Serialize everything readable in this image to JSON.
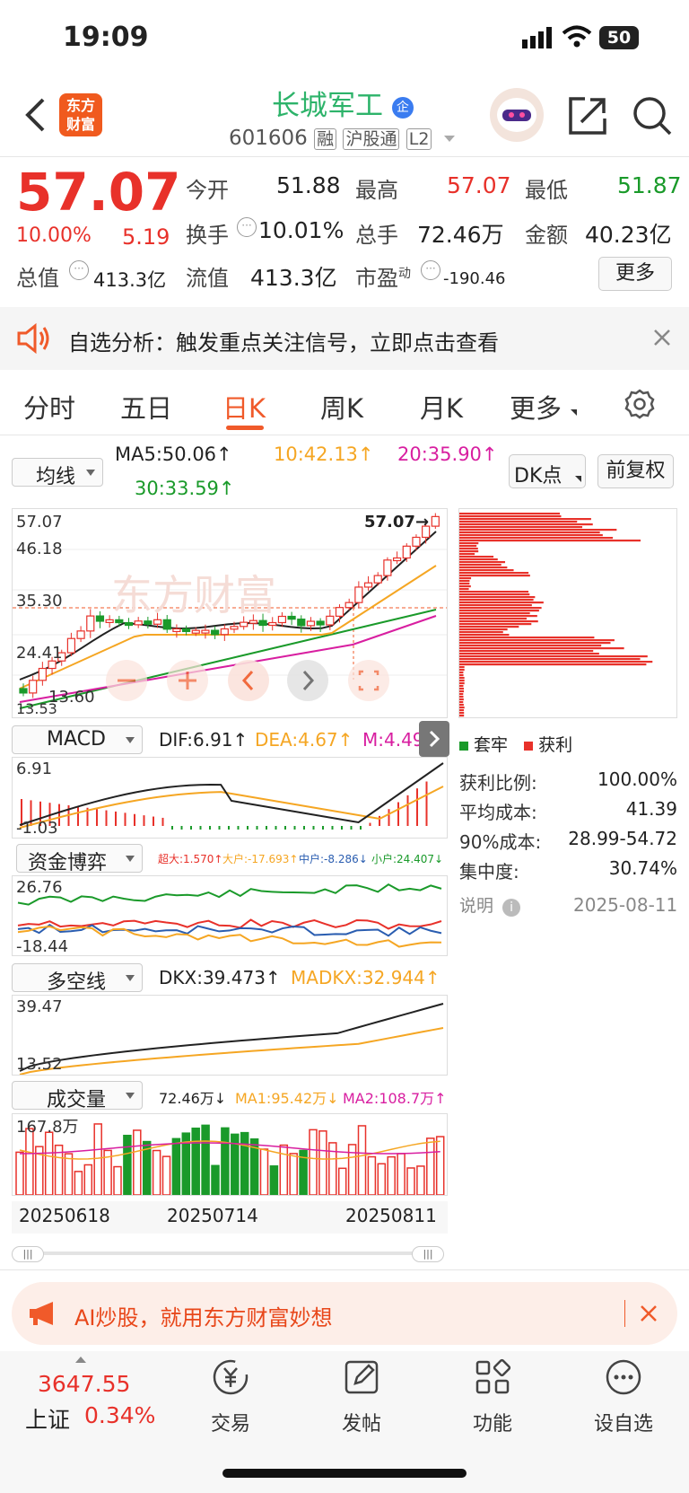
{
  "status_bar": {
    "time": "19:09",
    "battery": "50"
  },
  "header": {
    "logo_text_1": "东方",
    "logo_text_2": "财富",
    "title": "长城军工",
    "title_badge": "企",
    "code": "601606",
    "tags": [
      "融",
      "沪股通",
      "L2"
    ]
  },
  "quote": {
    "price": "57.07",
    "change_pct": "10.00%",
    "change": "5.19",
    "open_label": "今开",
    "open": "51.88",
    "high_label": "最高",
    "high": "57.07",
    "low_label": "最低",
    "low": "51.87",
    "turnover_label": "换手",
    "turnover": "10.01%",
    "volume_label": "总手",
    "volume": "72.46万",
    "amount_label": "金额",
    "amount": "40.23亿",
    "mktcap_label": "总值",
    "mktcap": "413.3亿",
    "float_label": "流值",
    "float": "413.3亿",
    "pe_label": "市盈",
    "pe_sup": "动",
    "pe": "-190.46",
    "more_button": "更多"
  },
  "banner": {
    "text": "自选分析：触发重点关注信号，立即点击查看"
  },
  "tabs": [
    "分时",
    "五日",
    "日K",
    "周K",
    "月K",
    "更多"
  ],
  "active_tab": 2,
  "kline": {
    "ma_selector": "均线",
    "ma5": "MA5:50.06↑",
    "ma10": "10:42.13↑",
    "ma20": "20:35.90↑",
    "ma30": "30:33.59↑",
    "dk_button": "DK点",
    "fq_button": "前复权",
    "y_labels": [
      "57.07",
      "46.18",
      "35.30",
      "24.41",
      "13.60",
      "13.53"
    ],
    "last_price_label": "57.07",
    "watermark": "东方财富",
    "colors": {
      "up": "#e8312a",
      "down": "#1a9a2a",
      "ma5": "#222222",
      "ma10": "#f5a623",
      "ma20": "#d81ea0",
      "ma30": "#1a9a2a"
    }
  },
  "chips": {
    "legend_trapped": "套牢",
    "legend_profit": "获利",
    "rows": [
      {
        "label": "获利比例:",
        "value": "100.00%"
      },
      {
        "label": "平均成本:",
        "value": "41.39"
      },
      {
        "label": "90%成本:",
        "value": "28.99-54.72"
      },
      {
        "label": "集中度:",
        "value": "30.74%"
      }
    ],
    "note_label": "说明",
    "date": "2025-08-11"
  },
  "macd": {
    "selector": "MACD",
    "dif": "DIF:6.91↑",
    "dea": "DEA:4.67↑",
    "m": "M:4.49↑",
    "y_top": "6.91",
    "y_bottom": "-1.03"
  },
  "fund": {
    "selector": "资金博弈",
    "super": "超大:1.570↑",
    "big": "大户:-17.693↑",
    "mid": "中户:-8.286↓",
    "small": "小户:24.407↓",
    "y_top": "26.76",
    "y_bottom": "-18.44"
  },
  "dkx": {
    "selector": "多空线",
    "dkx": "DKX:39.473↑",
    "madkx": "MADKX:32.944↑",
    "y_top": "39.47",
    "y_bottom": "13.52"
  },
  "vol": {
    "selector": "成交量",
    "vol": "72.46万↓",
    "ma1": "MA1:95.42万↓",
    "ma2": "MA2:108.7万↑",
    "y_top": "167.8万",
    "dates": [
      "20250618",
      "20250714",
      "20250811"
    ]
  },
  "ad": {
    "text": "AI炒股，就用东方财富妙想"
  },
  "bottom_nav": {
    "index_value": "3647.55",
    "index_name": "上证",
    "index_change": "0.34%",
    "items": [
      "交易",
      "发帖",
      "功能",
      "设自选"
    ]
  }
}
